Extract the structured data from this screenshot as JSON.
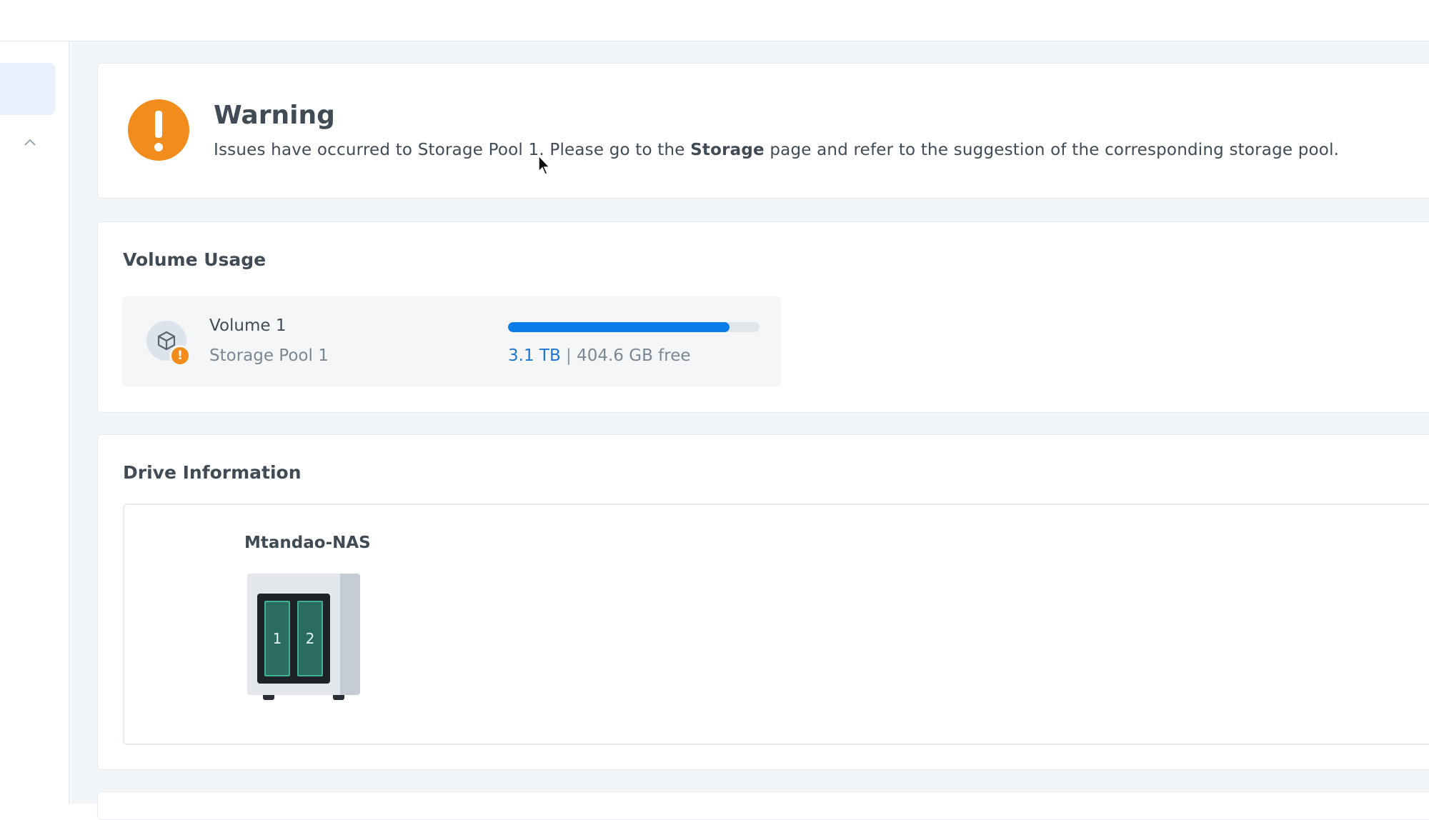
{
  "warning": {
    "title": "Warning",
    "message_part1": "Issues have occurred to Storage Pool 1. Please go to the ",
    "message_bold": "Storage",
    "message_part2": " page and refer to the suggestion of the corresponding storage pool."
  },
  "volume_usage": {
    "title": "Volume Usage",
    "volume": {
      "name": "Volume 1",
      "pool": "Storage Pool 1",
      "total": "3.1 TB",
      "separator": "|",
      "free": "404.6 GB free",
      "used_fraction": 0.88,
      "status_badge": "!"
    }
  },
  "drive_information": {
    "title": "Drive Information",
    "nas_name": "Mtandao-NAS",
    "bays": [
      "1",
      "2"
    ]
  },
  "icons": {
    "warning": "exclamation-circle-icon",
    "volume": "cube-icon",
    "collapse": "chevron-up-icon"
  },
  "colors": {
    "warning_orange": "#f28c1c",
    "progress_blue": "#0b7ce8",
    "drive_green": "#2a6d60"
  }
}
